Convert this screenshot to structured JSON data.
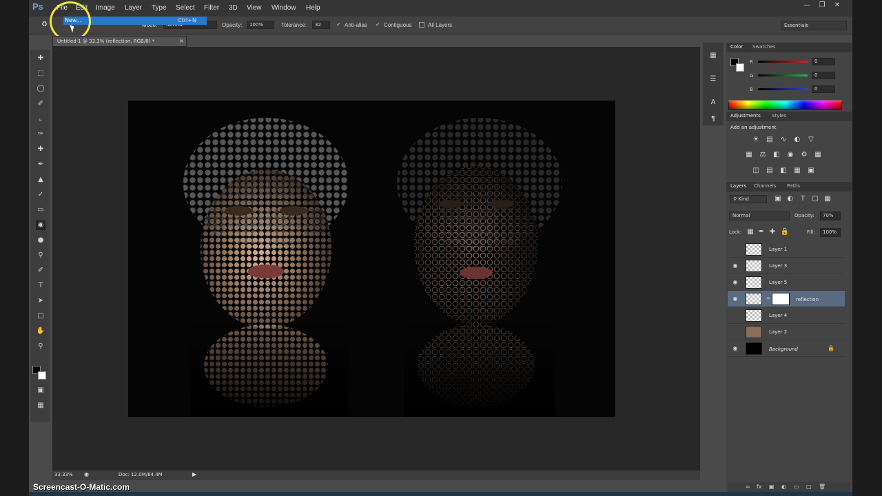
{
  "app": {
    "logo": "Ps"
  },
  "menu": [
    "File",
    "Edit",
    "Image",
    "Layer",
    "Type",
    "Select",
    "Filter",
    "3D",
    "View",
    "Window",
    "Help"
  ],
  "file_menu": {
    "highlighted_item": "New...",
    "shortcut": "Ctrl+N"
  },
  "options_bar": {
    "mode_label": "Mode:",
    "mode_value": "Normal",
    "opacity_label": "Opacity:",
    "opacity_value": "100%",
    "tolerance_label": "Tolerance:",
    "tolerance_value": "32",
    "antialias_label": "Anti-alias",
    "contiguous_label": "Contiguous",
    "all_layers_label": "All Layers",
    "workspace": "Essentials"
  },
  "document": {
    "tab_title": "Untitled-1 @ 33.3% (reflection, RGB/8) *"
  },
  "status": {
    "zoom": "33.33%",
    "doc_info": "Doc: 12.0M/64.4M"
  },
  "color_panel": {
    "tabs": [
      "Color",
      "Swatches"
    ],
    "channels": [
      {
        "label": "R",
        "value": "0",
        "color": "#d23a3a"
      },
      {
        "label": "G",
        "value": "0",
        "color": "#2fb04a"
      },
      {
        "label": "B",
        "value": "0",
        "color": "#3a4fd2"
      }
    ]
  },
  "adjustments_panel": {
    "tabs": [
      "Adjustments",
      "Styles"
    ],
    "heading": "Add an adjustment"
  },
  "layers_panel": {
    "tabs": [
      "Layers",
      "Channels",
      "Paths"
    ],
    "filter": "Kind",
    "blend_mode": "Normal",
    "opacity_label": "Opacity:",
    "opacity_value": "70%",
    "lock_label": "Lock:",
    "fill_label": "Fill:",
    "fill_value": "100%",
    "layers": [
      {
        "name": "Layer 1",
        "visible": false
      },
      {
        "name": "Layer 3",
        "visible": true
      },
      {
        "name": "Layer 5",
        "visible": true
      },
      {
        "name": "reflection",
        "visible": true,
        "selected": true
      },
      {
        "name": "Layer 4",
        "visible": false
      },
      {
        "name": "Layer 2",
        "visible": false
      },
      {
        "name": "Background",
        "visible": true,
        "locked": true
      }
    ]
  },
  "watermark": "Screencast-O-Matic.com"
}
